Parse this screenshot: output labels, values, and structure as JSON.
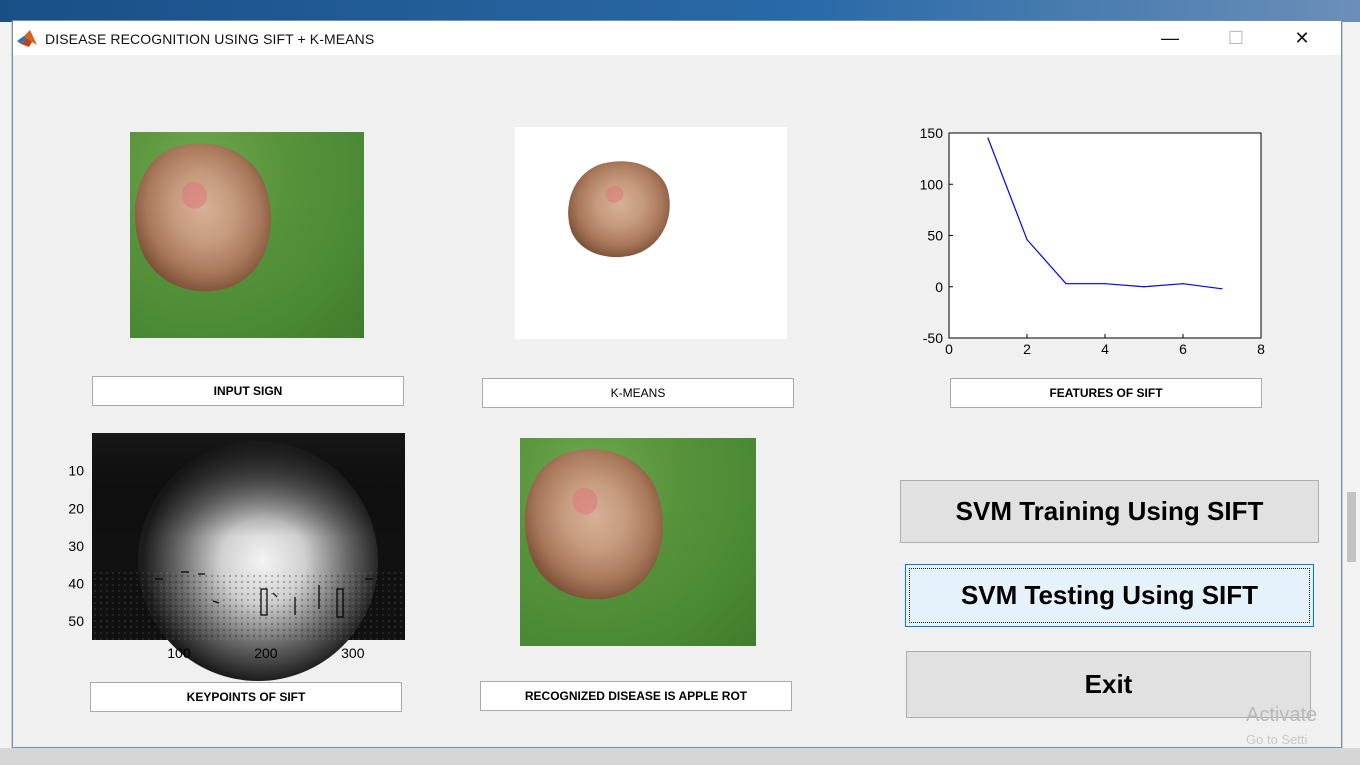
{
  "window": {
    "title": "DISEASE RECOGNITION USING SIFT + K-MEANS",
    "minimize": "—",
    "maximize": "☐",
    "close": "✕"
  },
  "labels": {
    "input_sign": "INPUT SIGN",
    "kmeans": "K-MEANS",
    "features": "FEATURES OF SIFT",
    "keypoints": "KEYPOINTS OF SIFT",
    "result": "RECOGNIZED DISEASE IS APPLE ROT"
  },
  "buttons": {
    "train": "SVM Training Using SIFT",
    "test": "SVM Testing Using SIFT",
    "exit": "Exit"
  },
  "watermark": {
    "line1": "Activate",
    "line2": "Go to Setti"
  },
  "chart_data": [
    {
      "type": "line",
      "x": [
        1,
        2,
        3,
        4,
        5,
        6,
        7
      ],
      "y": [
        145,
        46,
        3,
        3,
        0,
        3,
        -2
      ],
      "xlim": [
        0,
        8
      ],
      "ylim": [
        -50,
        150
      ],
      "xticks": [
        "0",
        "2",
        "4",
        "6",
        "8"
      ],
      "yticks": [
        "150",
        "100",
        "50",
        "0",
        "-50"
      ],
      "color": "#0000ff"
    },
    {
      "type": "heatmap",
      "xticks": [
        "100",
        "200",
        "300"
      ],
      "yticks": [
        "10",
        "20",
        "30",
        "40",
        "50"
      ],
      "colormap": "gray"
    }
  ]
}
